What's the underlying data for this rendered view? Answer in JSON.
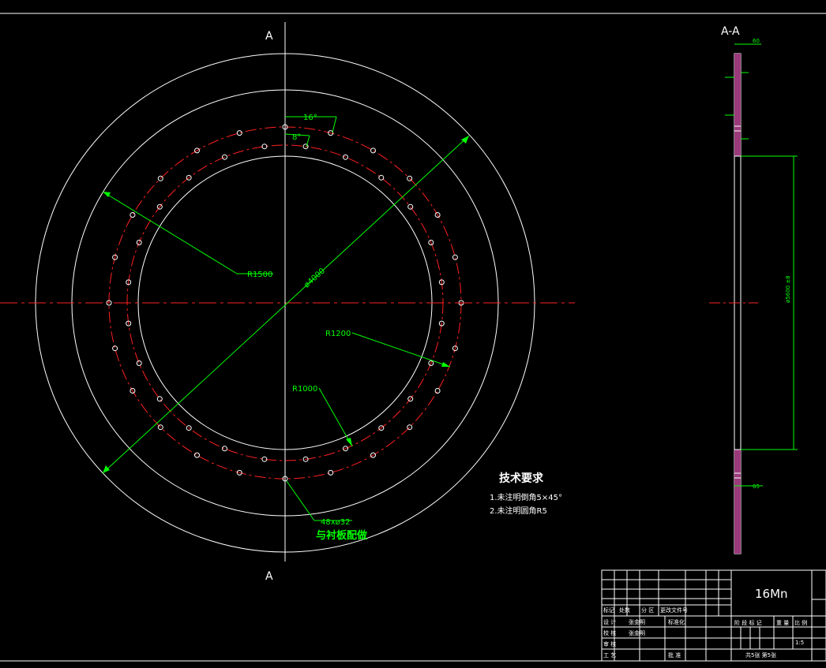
{
  "section": {
    "mark_top": "A",
    "mark_bottom": "A",
    "view_title": "A-A"
  },
  "dimensions": {
    "angle_outer": "16°",
    "angle_inner": "8°",
    "r_outer": "R1500",
    "diameter": "ø4000",
    "r_mid": "R1200",
    "r_inner": "R1000",
    "holes": "48xø32",
    "holes_note": "与衬板配做",
    "thickness_top": "60",
    "thickness_bottom": "65",
    "side_height": "ø5600 ±8"
  },
  "tech": {
    "title": "技术要求",
    "item1": "1.未注明倒角5×45°",
    "item2": "2.未注明圆角R5"
  },
  "title_block": {
    "material": "16Mn",
    "scale": "1:5",
    "sheets": "共5张  第5张",
    "row_mark": "标记",
    "row_count": "处数",
    "row_zone": "分 区",
    "row_doc": "更改文件号",
    "row_design": "设 计",
    "row_check": "校 核",
    "row_review": "审 核",
    "row_process": "工 艺",
    "row_standard": "标准化",
    "row_approve": "批 准",
    "designer": "张金明",
    "checker": "张金明",
    "stage_label": "阶 段 标 记",
    "weight_label": "重 量",
    "scale_label": "比 例"
  }
}
